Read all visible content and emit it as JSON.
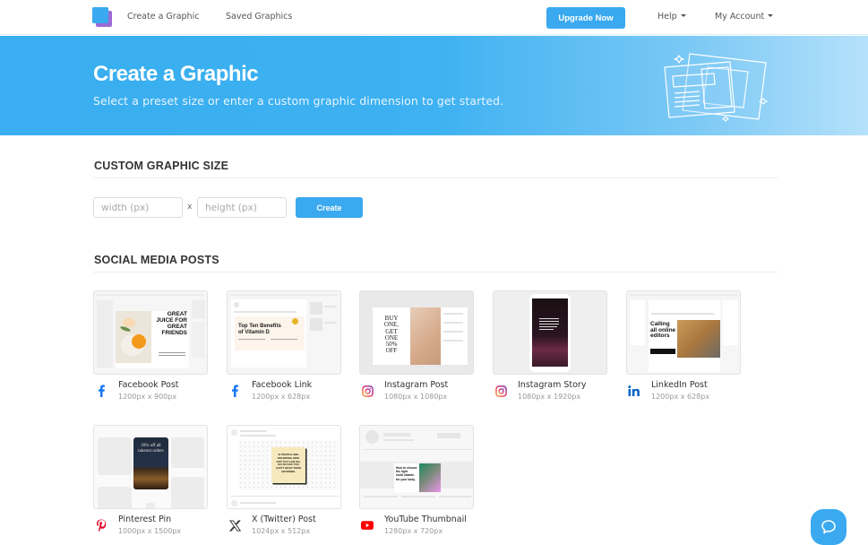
{
  "nav": {
    "logo": "app-logo",
    "links": [
      "Create a Graphic",
      "Saved Graphics"
    ],
    "upgrade_label": "Upgrade Now",
    "help_label": "Help",
    "account_label": "My Account"
  },
  "hero": {
    "title": "Create a Graphic",
    "subtitle": "Select a preset size or enter a custom graphic dimension to get started."
  },
  "custom": {
    "title": "CUSTOM GRAPHIC SIZE",
    "width_placeholder": "width (px)",
    "height_placeholder": "height (px)",
    "separator": "x",
    "create_label": "Create"
  },
  "social": {
    "title": "SOCIAL MEDIA POSTS",
    "items": [
      {
        "name": "Facebook Post",
        "size": "1200px x 900px",
        "icon": "facebook-icon",
        "thumb_text": [
          "GREAT",
          "JUICE FOR",
          "GREAT",
          "FRIENDS"
        ]
      },
      {
        "name": "Facebook Link",
        "size": "1200px x 628px",
        "icon": "facebook-icon",
        "thumb_text": [
          "Top Ten Benefits",
          "of Vitamin D"
        ]
      },
      {
        "name": "Instagram Post",
        "size": "1080px x 1080px",
        "icon": "instagram-icon",
        "thumb_text": [
          "BUY",
          "ONE,",
          "GET",
          "ONE",
          "50%",
          "OFF"
        ]
      },
      {
        "name": "Instagram Story",
        "size": "1080px x 1920px",
        "icon": "instagram-icon",
        "thumb_text": []
      },
      {
        "name": "LinkedIn Post",
        "size": "1200px x 628px",
        "icon": "linkedin-icon",
        "thumb_text": [
          "Calling",
          "all online",
          "editors"
        ]
      },
      {
        "name": "Pinterest Pin",
        "size": "1000px x 1500px",
        "icon": "pinterest-icon",
        "thumb_text": [
          "20% off all",
          "takeout orders"
        ]
      },
      {
        "name": "X (Twitter) Post",
        "size": "1024px x 512px",
        "icon": "x-twitter-icon",
        "thumb_text": [
          "IF PEOPLE ARE",
          "DOUBTING HOW",
          "FAR YOU CAN GO,",
          "GO SO FAR YOU",
          "CAN'T HEAR THEM",
          "ANYMORE."
        ]
      },
      {
        "name": "YouTube Thumbnail",
        "size": "1280px x 720px",
        "icon": "youtube-icon",
        "thumb_text": [
          "How to choose",
          "the right",
          "multi vitamin",
          "for your body"
        ]
      }
    ]
  },
  "colors": {
    "accent": "#3aa9ef",
    "logo_back": "#9a6bd6",
    "facebook": "#1877f2",
    "linkedin": "#0a66c2",
    "pinterest": "#e60023",
    "youtube": "#ff0000"
  }
}
